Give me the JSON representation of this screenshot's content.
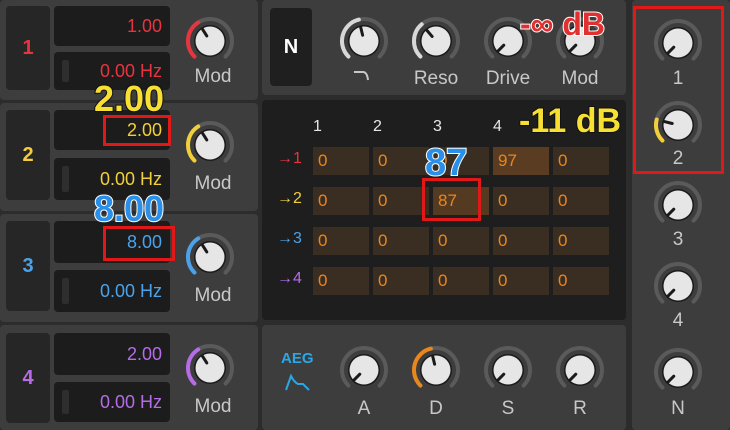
{
  "colors": {
    "red": "#e8343f",
    "yellow": "#f2cf3a",
    "blue": "#4aa3ea",
    "purple": "#b56ce6",
    "orange": "#e8871e",
    "aeg_blue": "#29a8e8",
    "callout_red": "#e03030",
    "callout_yellow": "#f7e032",
    "callout_blue": "#2a8fe8"
  },
  "lfos": [
    {
      "num": "1",
      "amount": "1.00",
      "rate": "0.00 Hz",
      "mod": "Mod"
    },
    {
      "num": "2",
      "amount": "2.00",
      "rate": "0.00 Hz",
      "mod": "Mod"
    },
    {
      "num": "3",
      "amount": "8.00",
      "rate": "0.00 Hz",
      "mod": "Mod"
    },
    {
      "num": "4",
      "amount": "2.00",
      "rate": "0.00 Hz",
      "mod": "Mod"
    }
  ],
  "filter": {
    "mode_button": "N",
    "cutoff_icon": "lowpass-curve-icon",
    "knobs": [
      "Reso",
      "Drive",
      "Mod"
    ]
  },
  "matrix": {
    "col_headers": [
      "1",
      "2",
      "3",
      "4"
    ],
    "rows": [
      {
        "label": "→1",
        "values": [
          "0",
          "0",
          "0",
          "97",
          "0"
        ]
      },
      {
        "label": "→2",
        "values": [
          "0",
          "0",
          "87",
          "0",
          "0"
        ]
      },
      {
        "label": "→3",
        "values": [
          "0",
          "0",
          "0",
          "0",
          "0"
        ]
      },
      {
        "label": "→4",
        "values": [
          "0",
          "0",
          "0",
          "0",
          "0"
        ]
      }
    ]
  },
  "envelope": {
    "label": "AEG",
    "icon": "envelope-shape-icon",
    "knobs": [
      "A",
      "D",
      "S",
      "R"
    ]
  },
  "outputs": {
    "knobs": [
      "1",
      "2",
      "3",
      "4",
      "N"
    ]
  },
  "callouts": {
    "inf_db": "-∞ dB",
    "minus11_db": "-11 dB",
    "v200": "2.00",
    "v800": "8.00",
    "v87": "87"
  }
}
